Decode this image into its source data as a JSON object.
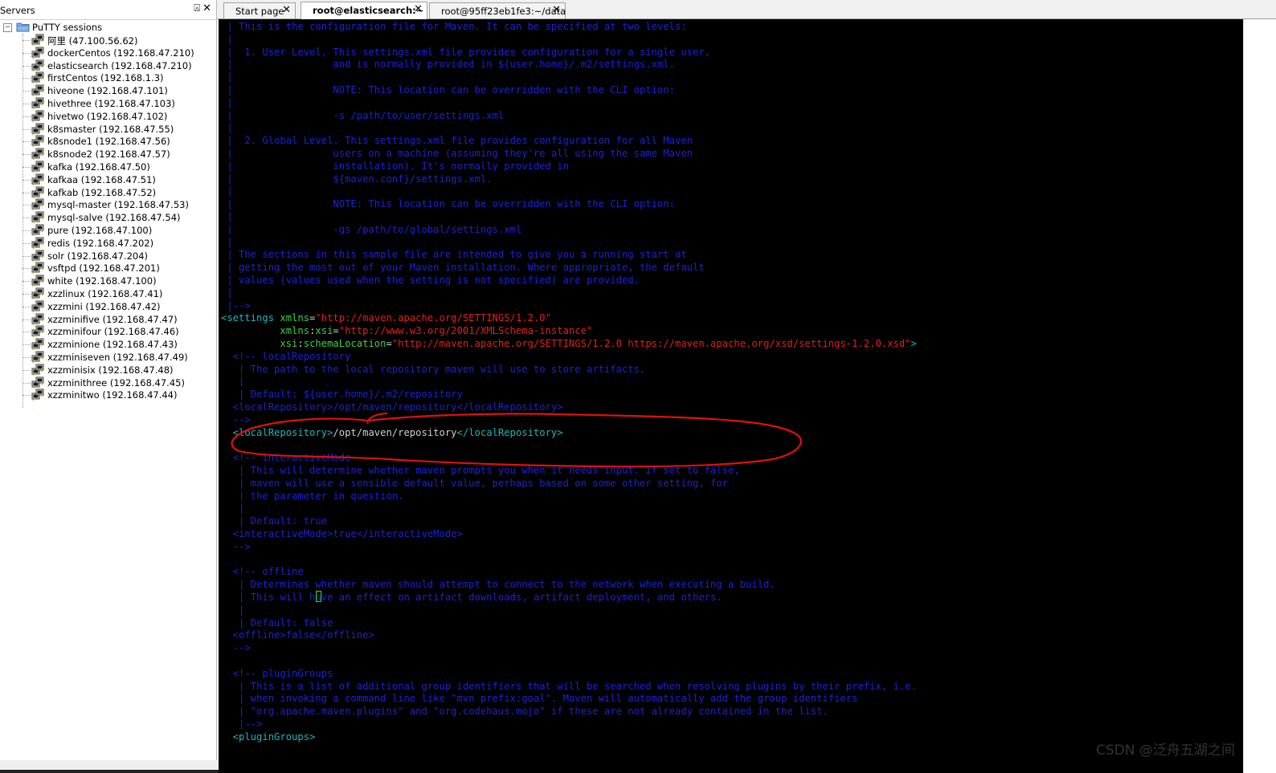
{
  "left_panel": {
    "title": "Servers",
    "pin_glyph": "⍓",
    "close_glyph": "✕",
    "tree": {
      "root_label": "PuTTY sessions",
      "expander_glyph": "−",
      "sessions": [
        {
          "label": "阿里 (47.100.56.62)"
        },
        {
          "label": "dockerCentos (192.168.47.210)"
        },
        {
          "label": "elasticsearch (192.168.47.210)"
        },
        {
          "label": "firstCentos (192.168.1.3)"
        },
        {
          "label": "hiveone (192.168.47.101)"
        },
        {
          "label": "hivethree (192.168.47.103)"
        },
        {
          "label": "hivetwo (192.168.47.102)"
        },
        {
          "label": "k8smaster (192.168.47.55)"
        },
        {
          "label": "k8snode1 (192.168.47.56)"
        },
        {
          "label": "k8snode2 (192.168.47.57)"
        },
        {
          "label": "kafka (192.168.47.50)"
        },
        {
          "label": "kafkaa (192.168.47.51)"
        },
        {
          "label": "kafkab (192.168.47.52)"
        },
        {
          "label": "mysql-master (192.168.47.53)"
        },
        {
          "label": "mysql-salve (192.168.47.54)"
        },
        {
          "label": "pure (192.168.47.100)"
        },
        {
          "label": "redis (192.168.47.202)"
        },
        {
          "label": "solr (192.168.47.204)"
        },
        {
          "label": "vsftpd (192.168.47.201)"
        },
        {
          "label": "white (192.168.47.100)"
        },
        {
          "label": "xzzlinux (192.168.47.41)"
        },
        {
          "label": "xzzmini (192.168.47.42)"
        },
        {
          "label": "xzzminifive (192.168.47.47)"
        },
        {
          "label": "xzzminifour (192.168.47.46)"
        },
        {
          "label": "xzzminione (192.168.47.43)"
        },
        {
          "label": "xzzminiseven (192.168.47.49)"
        },
        {
          "label": "xzzminisix (192.168.47.48)"
        },
        {
          "label": "xzzminithree (192.168.47.45)"
        },
        {
          "label": "xzzminitwo (192.168.47.44)"
        }
      ]
    }
  },
  "tabs": [
    {
      "label": "Start page",
      "active": false
    },
    {
      "label": "root@elasticsearch:~",
      "active": true
    },
    {
      "label": "root@95ff23eb1fe3:~/data",
      "active": false
    }
  ],
  "tab_close_glyph": "✕",
  "terminal": {
    "lines": [
      [
        [
          "blue",
          " | This is the configuration file for Maven. It can be specified at two levels:"
        ]
      ],
      [
        [
          "blue",
          " |"
        ]
      ],
      [
        [
          "blue",
          " |  1. User Level. This settings.xml file provides configuration for a single user,"
        ]
      ],
      [
        [
          "blue",
          " |                 and is normally provided in ${user.home}/.m2/settings.xml."
        ]
      ],
      [
        [
          "blue",
          " |"
        ]
      ],
      [
        [
          "blue",
          " |                 NOTE: This location can be overridden with the CLI option:"
        ]
      ],
      [
        [
          "blue",
          " |"
        ]
      ],
      [
        [
          "blue",
          " |                 -s /path/to/user/settings.xml"
        ]
      ],
      [
        [
          "blue",
          " |"
        ]
      ],
      [
        [
          "blue",
          " |  2. Global Level. This settings.xml file provides configuration for all Maven"
        ]
      ],
      [
        [
          "blue",
          " |                 users on a machine (assuming they're all using the same Maven"
        ]
      ],
      [
        [
          "blue",
          " |                 installation). It's normally provided in"
        ]
      ],
      [
        [
          "blue",
          " |                 ${maven.conf}/settings.xml."
        ]
      ],
      [
        [
          "blue",
          " |"
        ]
      ],
      [
        [
          "blue",
          " |                 NOTE: This location can be overridden with the CLI option:"
        ]
      ],
      [
        [
          "blue",
          " |"
        ]
      ],
      [
        [
          "blue",
          " |                 -gs /path/to/global/settings.xml"
        ]
      ],
      [
        [
          "blue",
          " |"
        ]
      ],
      [
        [
          "blue",
          " | The sections in this sample file are intended to give you a running start at"
        ]
      ],
      [
        [
          "blue",
          " | getting the most out of your Maven installation. Where appropriate, the default"
        ]
      ],
      [
        [
          "blue",
          " | values (values used when the setting is not specified) are provided."
        ]
      ],
      [
        [
          "blue",
          " |"
        ]
      ],
      [
        [
          "blue",
          " |-->"
        ]
      ],
      [
        [
          "cyan",
          "<settings "
        ],
        [
          "green",
          "xmlns"
        ],
        [
          "white",
          "="
        ],
        [
          "red",
          "\"http://maven.apache.org/SETTINGS/1.2.0\""
        ]
      ],
      [
        [
          "white",
          "          "
        ],
        [
          "green",
          "xmlns"
        ],
        [
          "white",
          ":"
        ],
        [
          "green",
          "xsi"
        ],
        [
          "white",
          "="
        ],
        [
          "red",
          "\"http://www.w3.org/2001/XMLSchema-instance\""
        ]
      ],
      [
        [
          "white",
          "          "
        ],
        [
          "green",
          "xsi"
        ],
        [
          "white",
          ":"
        ],
        [
          "green",
          "schemaLocation"
        ],
        [
          "white",
          "="
        ],
        [
          "red",
          "\"http://maven.apache.org/SETTINGS/1.2.0 https://maven.apache.org/xsd/settings-1.2.0.xsd\""
        ],
        [
          "cyan",
          ">"
        ]
      ],
      [
        [
          "blue",
          "  <!-- localRepository"
        ]
      ],
      [
        [
          "blue",
          "   | The path to the local repository maven will use to store artifacts."
        ]
      ],
      [
        [
          "blue",
          "   |"
        ]
      ],
      [
        [
          "blue",
          "   | Default: ${user.home}/.m2/repository"
        ]
      ],
      [
        [
          "blue",
          "  <localRepository>/opt/maven/repository</localRepository>"
        ]
      ],
      [
        [
          "blue",
          "  -->"
        ]
      ],
      [
        [
          "cyan",
          "  <localRepository>"
        ],
        [
          "white",
          "/opt/maven/repository"
        ],
        [
          "cyan",
          "</localRepository>"
        ]
      ],
      [
        [
          "blue",
          ""
        ]
      ],
      [
        [
          "blue",
          "  <!-- interactiveMode"
        ]
      ],
      [
        [
          "blue",
          "   | This will determine whether maven prompts you when it needs input. If set to false,"
        ]
      ],
      [
        [
          "blue",
          "   | maven will use a sensible default value, perhaps based on some other setting, for"
        ]
      ],
      [
        [
          "blue",
          "   | the parameter in question."
        ]
      ],
      [
        [
          "blue",
          "   |"
        ]
      ],
      [
        [
          "blue",
          "   | Default: true"
        ]
      ],
      [
        [
          "blue",
          "  <interactiveMode>true</interactiveMode>"
        ]
      ],
      [
        [
          "blue",
          "  -->"
        ]
      ],
      [
        [
          "blue",
          ""
        ]
      ],
      [
        [
          "blue",
          "  <!-- offline"
        ]
      ],
      [
        [
          "blue",
          "   | Determines whether maven should attempt to connect to the network when executing a build."
        ]
      ],
      [
        [
          "blue",
          "   | This will have an effect on artifact downloads, artifact deployment, and others."
        ]
      ],
      [
        [
          "blue",
          "   |"
        ]
      ],
      [
        [
          "blue",
          "   | Default: false"
        ]
      ],
      [
        [
          "blue",
          "  <offline>false</offline>"
        ]
      ],
      [
        [
          "blue",
          "  -->"
        ]
      ],
      [
        [
          "blue",
          ""
        ]
      ],
      [
        [
          "blue",
          "  <!-- pluginGroups"
        ]
      ],
      [
        [
          "blue",
          "   | This is a list of additional group identifiers that will be searched when resolving plugins by their prefix, i.e."
        ]
      ],
      [
        [
          "blue",
          "   | when invoking a command line like \"mvn prefix:goal\". Maven will automatically add the group identifiers"
        ]
      ],
      [
        [
          "blue",
          "   | \"org.apache.maven.plugins\" and \"org.codehaus.mojo\" if these are not already contained in the list."
        ]
      ],
      [
        [
          "blue",
          "   |-->"
        ]
      ],
      [
        [
          "cyan",
          "  <pluginGroups>"
        ]
      ]
    ]
  },
  "annotation_color": "#e01010",
  "watermark": "CSDN @泛舟五湖之间"
}
